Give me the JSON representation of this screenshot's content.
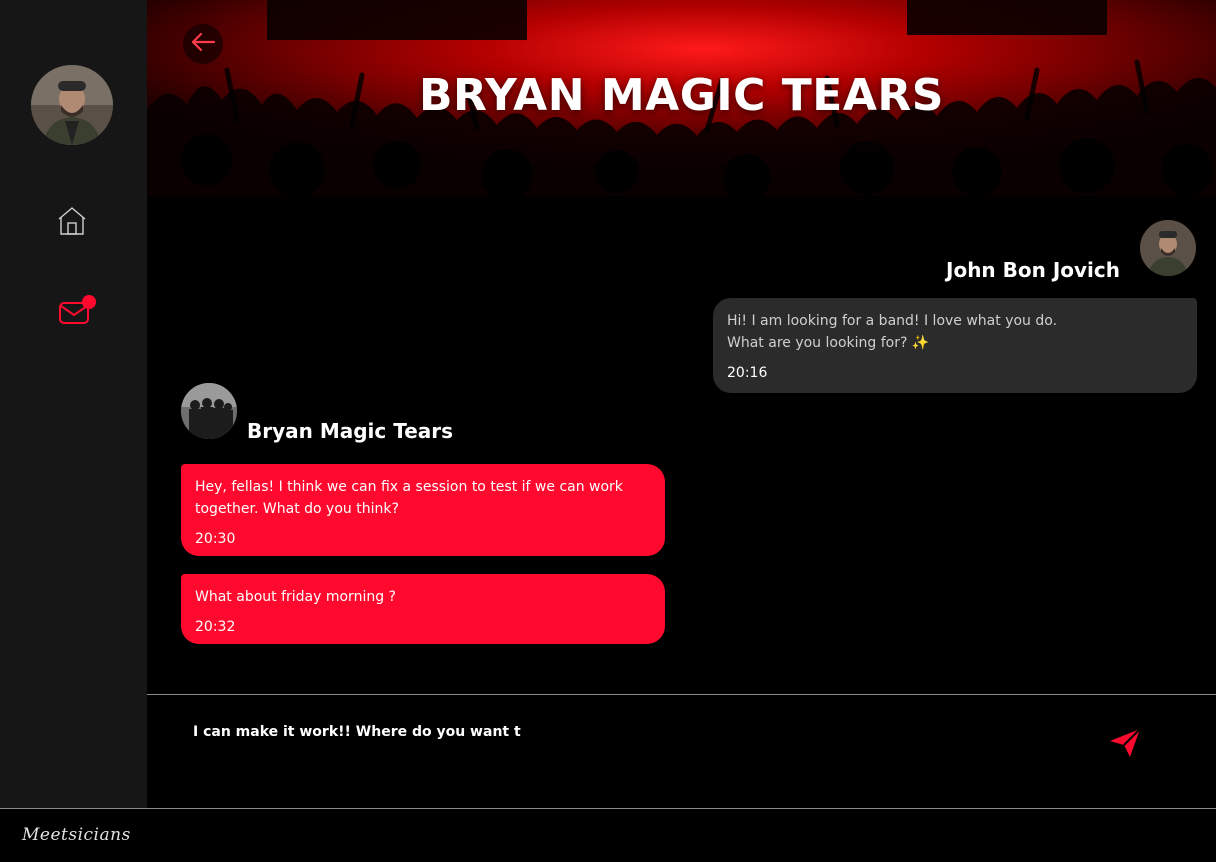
{
  "app": {
    "accent_color": "#ff0a2e",
    "brand_logo": "Meetsicians"
  },
  "sidebar": {
    "avatar_alt": "user-avatar",
    "items": [
      {
        "icon": "home-icon"
      },
      {
        "icon": "mail-icon",
        "has_notification": true
      }
    ]
  },
  "header": {
    "title": "BRYAN MAGIC TEARS",
    "back_icon": "arrow-left-icon"
  },
  "conversation": {
    "messages": [
      {
        "sender": "John Bon Jovich",
        "side": "right",
        "lines": [
          "Hi! I am looking for a band! I love what you do.",
          "What are you looking for? ✨"
        ],
        "time": "20:16"
      },
      {
        "sender": "Bryan Magic Tears",
        "side": "left",
        "lines": [
          "Hey, fellas! I think we can fix a session to test if we can work",
          "together. What do you think?"
        ],
        "time": "20:30"
      },
      {
        "sender": "Bryan Magic Tears",
        "side": "left",
        "lines": [
          "What about friday morning ?"
        ],
        "time": "20:32"
      }
    ]
  },
  "composer": {
    "value": "I can make it work!! Where do you want t",
    "send_icon": "send-icon"
  }
}
